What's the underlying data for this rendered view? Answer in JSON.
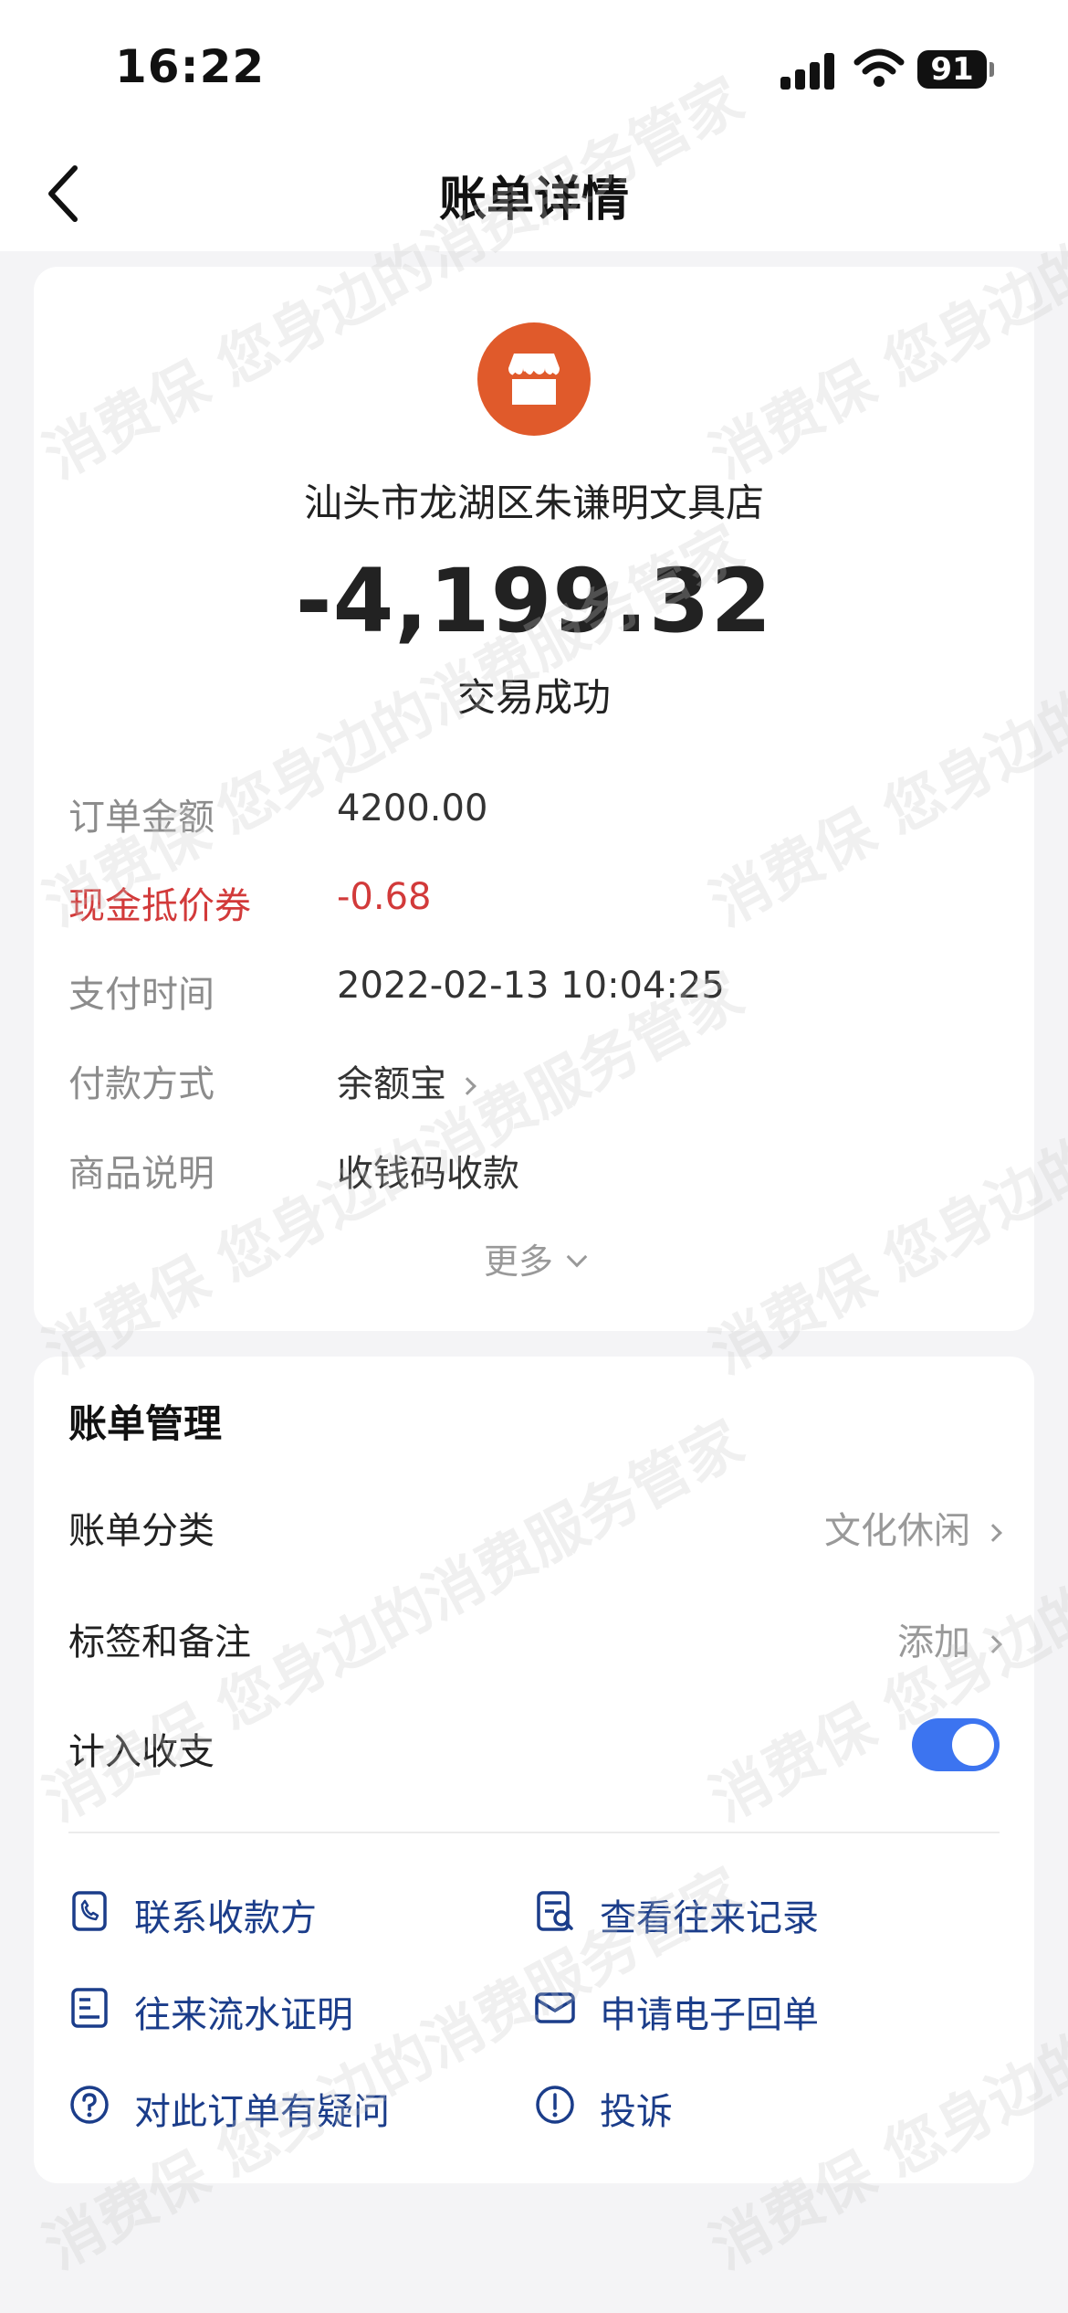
{
  "status_bar": {
    "time": "16:22",
    "battery": "91"
  },
  "nav": {
    "title": "账单详情"
  },
  "summary": {
    "merchant_name": "汕头市龙湖区朱谦明文具店",
    "amount": "-4,199.32",
    "status": "交易成功",
    "details": [
      {
        "label": "订单金额",
        "value": "4200.00"
      },
      {
        "label": "现金抵价券",
        "value": "-0.68"
      },
      {
        "label": "支付时间",
        "value": "2022-02-13 10:04:25"
      },
      {
        "label": "付款方式",
        "value": "余额宝"
      },
      {
        "label": "商品说明",
        "value": "收钱码收款"
      }
    ],
    "more_label": "更多"
  },
  "manage": {
    "title": "账单管理",
    "category_label": "账单分类",
    "category_value": "文化休闲",
    "tag_label": "标签和备注",
    "tag_value": "添加",
    "include_label": "计入收支",
    "include_enabled": true,
    "actions": [
      {
        "label": "联系收款方",
        "icon": "phone-icon"
      },
      {
        "label": "查看往来记录",
        "icon": "record-search-icon"
      },
      {
        "label": "往来流水证明",
        "icon": "document-icon"
      },
      {
        "label": "申请电子回单",
        "icon": "mail-icon"
      },
      {
        "label": "对此订单有疑问",
        "icon": "question-icon"
      },
      {
        "label": "投诉",
        "icon": "alert-icon"
      }
    ]
  },
  "watermark": "消费保 您身边的消费服务管家",
  "colors": {
    "accent": "#3c74f0",
    "merchant_icon": "#e05a2b",
    "coupon": "#d23a3a",
    "action_text": "#1b3d8a"
  }
}
